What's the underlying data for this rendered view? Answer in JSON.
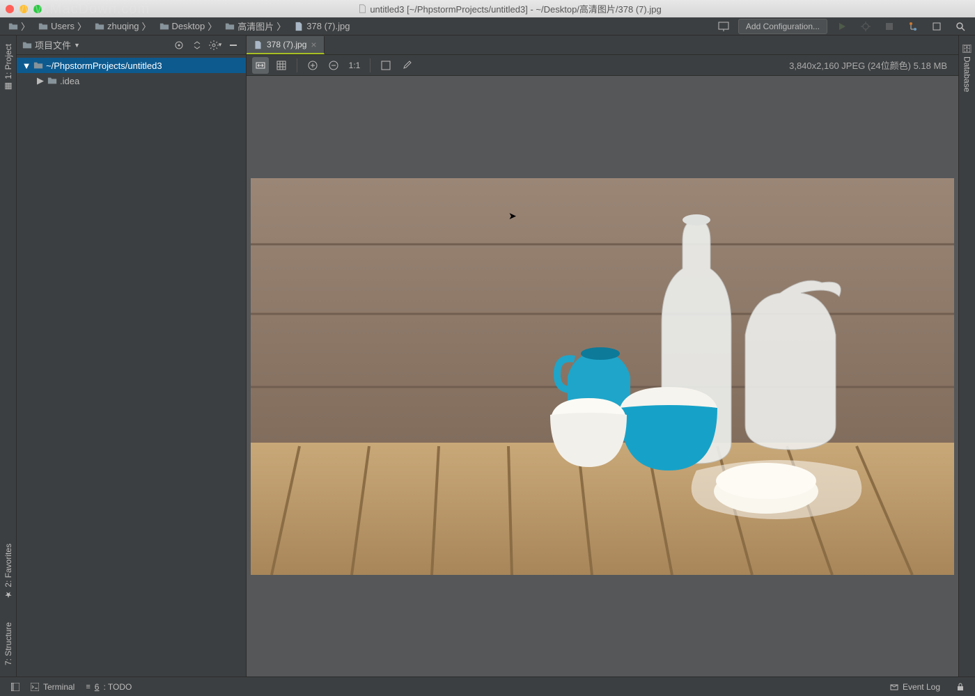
{
  "window": {
    "title": "untitled3 [~/PhpstormProjects/untitled3] - ~/Desktop/高清图片/378 (7).jpg",
    "watermark": "www.MacDown.com"
  },
  "breadcrumbs": [
    "Users",
    "zhuqing",
    "Desktop",
    "高清图片",
    "378 (7).jpg"
  ],
  "toolbar_right": {
    "add_config": "Add Configuration..."
  },
  "sidebar": {
    "title": "项目文件",
    "root": "~/PhpstormProjects/untitled3",
    "items": [
      {
        "label": ".idea"
      }
    ]
  },
  "panels_left": [
    {
      "id": "project",
      "label": "1: Project"
    },
    {
      "id": "favorites",
      "label": "2: Favorites"
    },
    {
      "id": "structure",
      "label": "7: Structure"
    }
  ],
  "panels_right": [
    {
      "id": "database",
      "label": "Database"
    }
  ],
  "tab": {
    "name": "378 (7).jpg"
  },
  "image_toolbar": {
    "one_to_one": "1:1"
  },
  "image_info": "3,840x2,160 JPEG (24位颜色) 5.18 MB",
  "statusbar": {
    "terminal": "Terminal",
    "todo": "6: TODO",
    "eventlog": "Event Log"
  }
}
